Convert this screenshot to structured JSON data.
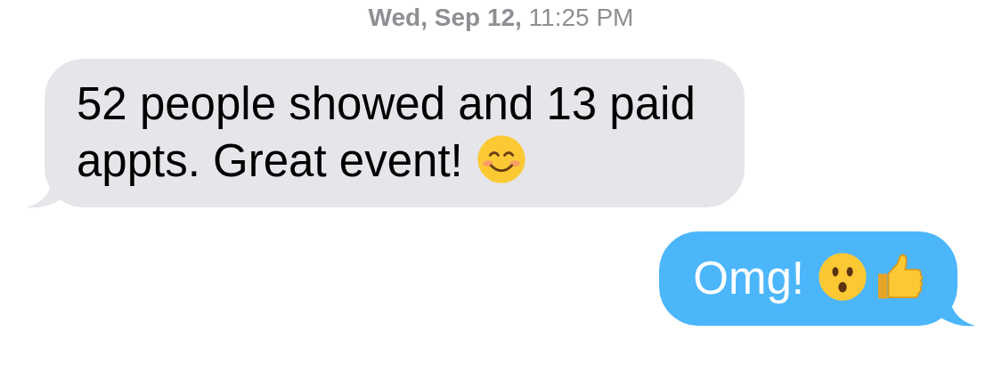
{
  "timestamp": "**Wed, Sep 12,** 11:25 PM",
  "messages": [
    {
      "sent": false,
      "text": "52 people showed and 13 paid appts. Great event!",
      "emoji": [
        {
          "kind": "smiling"
        }
      ]
    },
    {
      "sent": true,
      "text": "Omg!",
      "emoji": [
        {
          "kind": "hushed"
        },
        {
          "kind": "thumbs-up"
        }
      ]
    }
  ]
}
